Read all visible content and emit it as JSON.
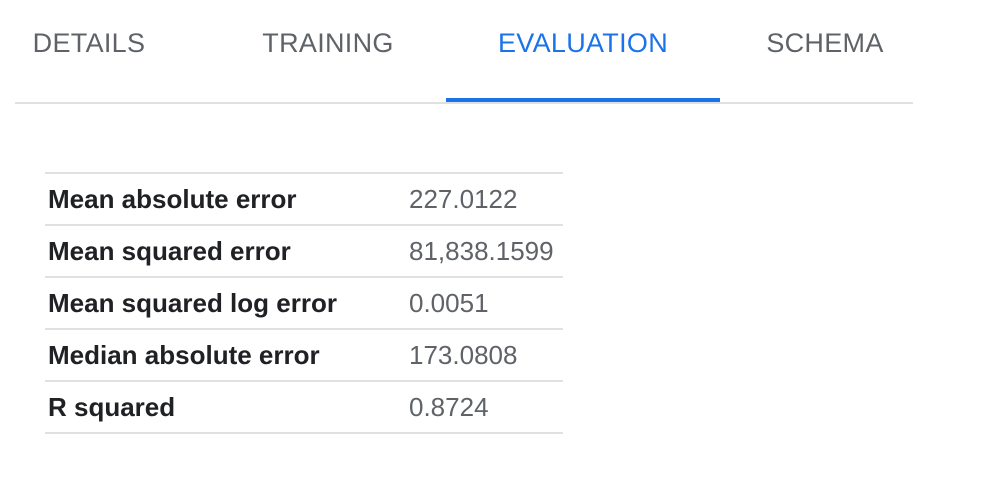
{
  "tabs": [
    {
      "label": "DETAILS",
      "active": false
    },
    {
      "label": "TRAINING",
      "active": false
    },
    {
      "label": "EVALUATION",
      "active": true
    },
    {
      "label": "SCHEMA",
      "active": false
    }
  ],
  "metrics": [
    {
      "name": "Mean absolute error",
      "value": "227.0122"
    },
    {
      "name": "Mean squared error",
      "value": "81,838.1599"
    },
    {
      "name": "Mean squared log error",
      "value": "0.0051"
    },
    {
      "name": "Median absolute error",
      "value": "173.0808"
    },
    {
      "name": "R squared",
      "value": "0.8724"
    }
  ],
  "colors": {
    "accent": "#1a73e8",
    "tab_inactive": "#5f6368",
    "divider": "#e0e0e0",
    "metric_name": "#202124",
    "metric_value": "#5f6368"
  }
}
